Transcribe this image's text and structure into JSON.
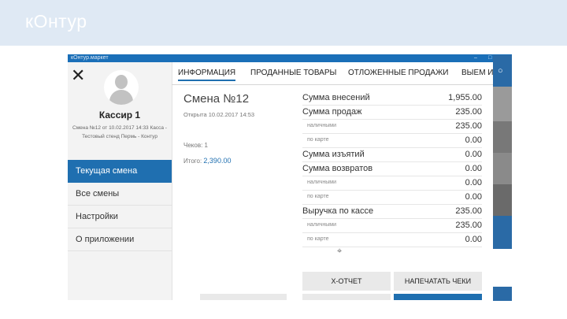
{
  "brand": {
    "logo": "кОнтур"
  },
  "titlebar": {
    "title": "кОнтур.маркет",
    "minimize": "–",
    "maximize": "□",
    "close": "×"
  },
  "sidebar": {
    "close": "✕",
    "cashier_name": "Кассир 1",
    "cashier_info": "Смена №12 от 10.02.2017 14:33 Касса - Тестовый стенд Пермь - Контур",
    "items": [
      {
        "label": "Текущая смена"
      },
      {
        "label": "Все смены"
      },
      {
        "label": "Настройки"
      },
      {
        "label": "О приложении"
      }
    ]
  },
  "tabs": [
    {
      "label": "ИНФОРМАЦИЯ"
    },
    {
      "label": "ПРОДАННЫЕ ТОВАРЫ"
    },
    {
      "label": "ОТЛОЖЕННЫЕ ПРОДАЖИ"
    },
    {
      "label": "ВЫЕМ И"
    }
  ],
  "shift": {
    "title": "Смена №12",
    "opened": "Открыта 10.02.2017 14:53",
    "checks_label": "Чеков:",
    "checks_value": "1",
    "total_label": "Итого:",
    "total_value": "2,390.00"
  },
  "summary": [
    {
      "label": "Сумма внесений",
      "value": "1,955.00",
      "sub": false
    },
    {
      "label": "Сумма продаж",
      "value": "235.00",
      "sub": false
    },
    {
      "label": "наличными",
      "value": "235.00",
      "sub": true
    },
    {
      "label": "по карте",
      "value": "0.00",
      "sub": true
    },
    {
      "label": "Сумма изъятий",
      "value": "0.00",
      "sub": false
    },
    {
      "label": "Сумма возвратов",
      "value": "0.00",
      "sub": false
    },
    {
      "label": "наличными",
      "value": "0.00",
      "sub": true
    },
    {
      "label": "по карте",
      "value": "0.00",
      "sub": true
    },
    {
      "label": "Выручка по кассе",
      "value": "235.00",
      "sub": false
    },
    {
      "label": "наличными",
      "value": "235.00",
      "sub": true
    },
    {
      "label": "по карте",
      "value": "0.00",
      "sub": true
    }
  ],
  "buttons": {
    "x_report": "Х-ОТЧЕТ",
    "print_checks": "НАПЕЧАТАТЬ ЧЕКИ"
  },
  "colors": {
    "accent": "#1f6fb0",
    "brand_bar": "#dfe9f4"
  }
}
